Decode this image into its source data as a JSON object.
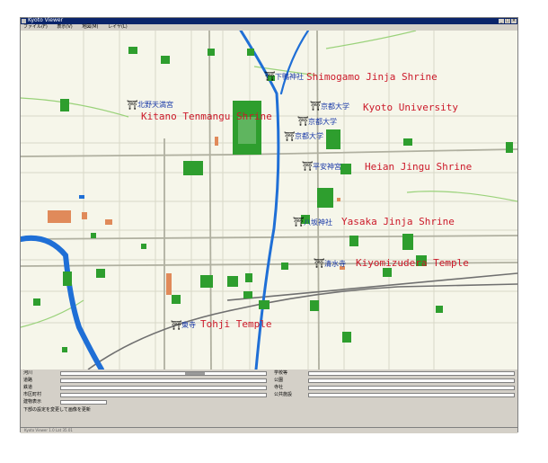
{
  "window": {
    "title": "Kyoto Viewer"
  },
  "menu": [
    "ファイル(F)",
    "表示(V)",
    "地図(M)",
    "レイヤ(L)"
  ],
  "landmarks": [
    {
      "ja": "下鴨神社",
      "en": "Shimogamo Jinja Shrine"
    },
    {
      "ja": "北野天満宮",
      "en": "Kitano Tenmangu Shrine"
    },
    {
      "ja": "京都大学",
      "en": "Kyoto University"
    },
    {
      "ja": "京都大学",
      "en": ""
    },
    {
      "ja": "京都大学",
      "en": ""
    },
    {
      "ja": "平安神宮",
      "en": "Heian Jingu Shrine"
    },
    {
      "ja": "八坂神社",
      "en": "Yasaka Jinja Shrine"
    },
    {
      "ja": "清水寺",
      "en": "Kiyomizudera Temple"
    },
    {
      "ja": "東寺",
      "en": "Tohji Temple"
    }
  ],
  "layers_left": [
    {
      "name": "河川",
      "level": 0.67
    },
    {
      "name": "道路",
      "level": 0
    },
    {
      "name": "鉄道",
      "level": 0
    },
    {
      "name": "市区町村",
      "level": 0
    },
    {
      "name": "建物表示",
      "level": 0
    }
  ],
  "layers_right": [
    {
      "name": "学校等",
      "level": 0
    },
    {
      "name": "公園",
      "level": 0
    },
    {
      "name": "寺社",
      "level": 0
    },
    {
      "name": "公共施設",
      "level": 0
    }
  ],
  "panel": {
    "hint": "下部の設定を変更して画像を更新"
  },
  "status": {
    "text": "Kyoto Viewer 1.0 Lat 35.01"
  }
}
